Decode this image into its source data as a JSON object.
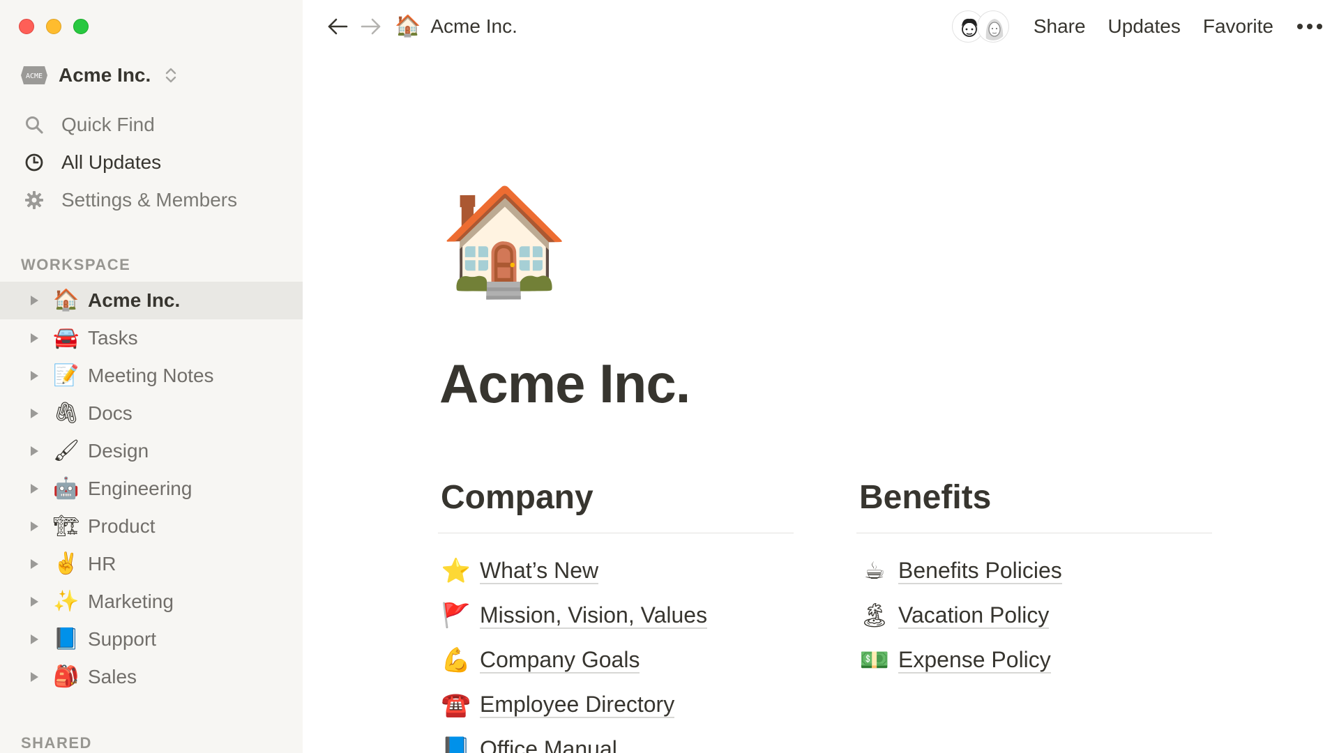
{
  "sidebar": {
    "workspace_name": "Acme Inc.",
    "workspace_logo": "ACME",
    "menu": [
      {
        "label": "Quick Find",
        "icon": "search-icon"
      },
      {
        "label": "All Updates",
        "icon": "clock-icon"
      },
      {
        "label": "Settings & Members",
        "icon": "gear-icon"
      }
    ],
    "workspace_section": "WORKSPACE",
    "pages": [
      {
        "emoji": "🏠",
        "label": "Acme Inc."
      },
      {
        "emoji": "🚘",
        "label": "Tasks"
      },
      {
        "emoji": "📝",
        "label": "Meeting Notes"
      },
      {
        "emoji": "🖇",
        "label": "Docs"
      },
      {
        "emoji": "🖌",
        "label": "Design"
      },
      {
        "emoji": "🤖",
        "label": "Engineering"
      },
      {
        "emoji": "🏗",
        "label": "Product"
      },
      {
        "emoji": "✌️",
        "label": "HR"
      },
      {
        "emoji": "✨",
        "label": "Marketing"
      },
      {
        "emoji": "📘",
        "label": "Support"
      },
      {
        "emoji": "🎒",
        "label": "Sales"
      }
    ],
    "shared_section": "SHARED"
  },
  "topbar": {
    "breadcrumb_emoji": "🏠",
    "breadcrumb_label": "Acme Inc.",
    "share": "Share",
    "updates": "Updates",
    "favorite": "Favorite"
  },
  "page": {
    "icon": "🏠",
    "title": "Acme Inc.",
    "company": {
      "heading": "Company",
      "links": [
        {
          "emoji": "⭐",
          "label": "What’s New"
        },
        {
          "emoji": "🚩",
          "label": "Mission, Vision, Values"
        },
        {
          "emoji": "💪",
          "label": "Company Goals"
        },
        {
          "emoji": "☎️",
          "label": "Employee Directory"
        },
        {
          "emoji": "📘",
          "label": "Office Manual"
        }
      ]
    },
    "benefits": {
      "heading": "Benefits",
      "links": [
        {
          "emoji": "☕",
          "label": "Benefits Policies"
        },
        {
          "emoji": "🏝",
          "label": "Vacation Policy"
        },
        {
          "emoji": "💵",
          "label": "Expense Policy"
        }
      ]
    }
  },
  "colors": {
    "sidebar_bg": "#f7f6f3",
    "active_bg": "#e9e8e4",
    "text": "#37352f"
  }
}
